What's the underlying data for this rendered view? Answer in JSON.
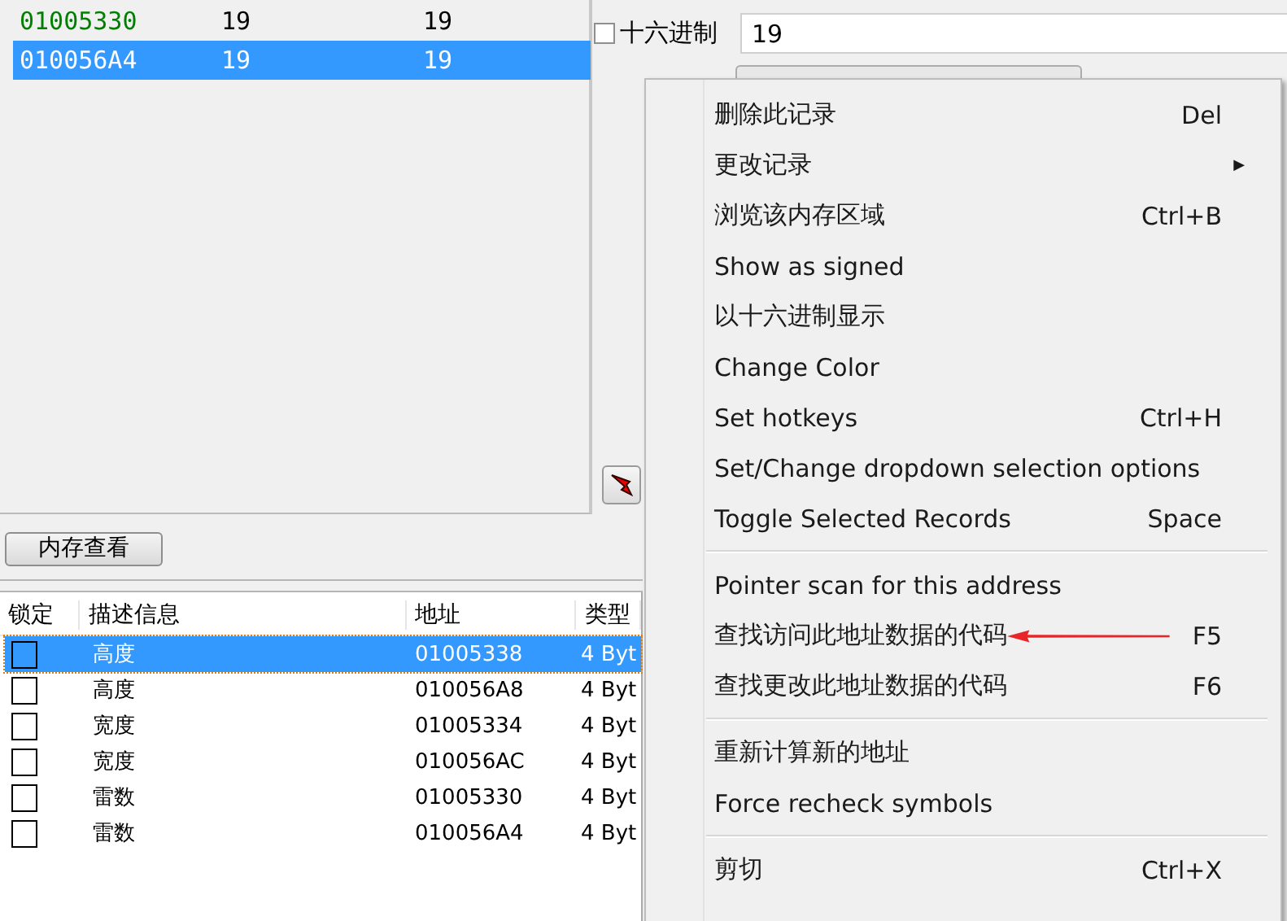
{
  "results": [
    {
      "address": "01005330",
      "value": "19",
      "previous": "19",
      "selected": false,
      "color": "#008000"
    },
    {
      "address": "010056A4",
      "value": "19",
      "previous": "19",
      "selected": true
    }
  ],
  "hex": {
    "label": "十六进制",
    "checked": false
  },
  "value_field": {
    "value": "19"
  },
  "memory_view_button": "内存查看",
  "table": {
    "columns": [
      "锁定",
      "描述信息",
      "地址",
      "类型"
    ],
    "rows": [
      {
        "locked": false,
        "selected": true,
        "description": "高度",
        "address": "01005338",
        "type": "4 Byt"
      },
      {
        "locked": false,
        "selected": false,
        "description": "高度",
        "address": "010056A8",
        "type": "4 Byt"
      },
      {
        "locked": false,
        "selected": false,
        "description": "宽度",
        "address": "01005334",
        "type": "4 Byt"
      },
      {
        "locked": false,
        "selected": false,
        "description": "宽度",
        "address": "010056AC",
        "type": "4 Byt"
      },
      {
        "locked": false,
        "selected": false,
        "description": "雷数",
        "address": "01005330",
        "type": "4 Byt"
      },
      {
        "locked": false,
        "selected": false,
        "description": "雷数",
        "address": "010056A4",
        "type": "4 Byt"
      }
    ]
  },
  "context_menu": [
    {
      "kind": "item",
      "label": "删除此记录",
      "shortcut": "Del"
    },
    {
      "kind": "submenu",
      "label": "更改记录",
      "shortcut": "▶"
    },
    {
      "kind": "item",
      "label": "浏览该内存区域",
      "shortcut": "Ctrl+B"
    },
    {
      "kind": "item",
      "label": "Show as signed"
    },
    {
      "kind": "item",
      "label": "以十六进制显示"
    },
    {
      "kind": "item",
      "label": "Change Color"
    },
    {
      "kind": "item",
      "label": "Set hotkeys",
      "shortcut": "Ctrl+H"
    },
    {
      "kind": "item",
      "label": "Set/Change dropdown selection options"
    },
    {
      "kind": "item",
      "label": "Toggle Selected Records",
      "shortcut": "Space"
    },
    {
      "kind": "separator"
    },
    {
      "kind": "item",
      "label": "Pointer scan for this address"
    },
    {
      "kind": "item",
      "label": "查找访问此地址数据的代码",
      "shortcut": "F5",
      "annotated": true
    },
    {
      "kind": "item",
      "label": "查找更改此地址数据的代码",
      "shortcut": "F6"
    },
    {
      "kind": "separator"
    },
    {
      "kind": "item",
      "label": "重新计算新的地址"
    },
    {
      "kind": "item",
      "label": "Force recheck symbols"
    },
    {
      "kind": "separator"
    },
    {
      "kind": "item",
      "label": "剪切",
      "shortcut": "Ctrl+X"
    }
  ]
}
